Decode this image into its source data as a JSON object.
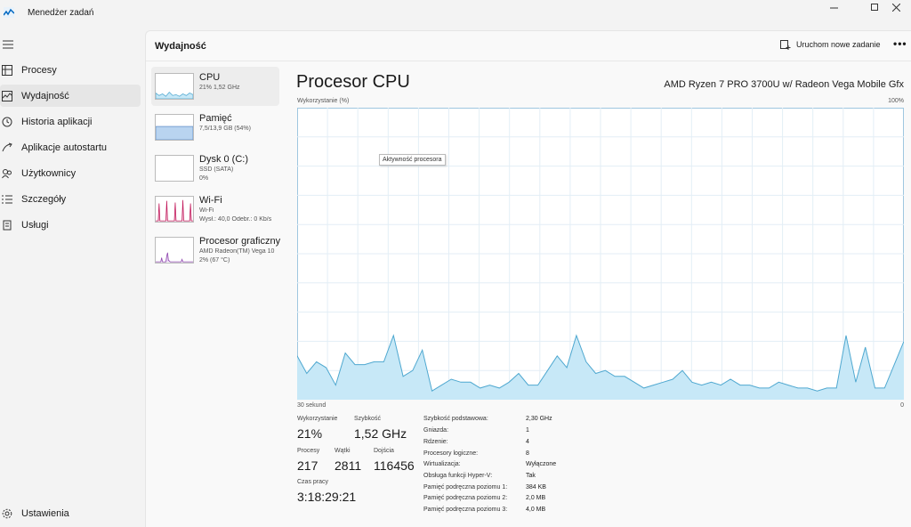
{
  "app": {
    "title": "Menedżer zadań",
    "accent": "#0067c0"
  },
  "nav": {
    "toggle_icon": "hamburger-icon",
    "items": [
      {
        "label": "Procesy",
        "icon": "processes-icon"
      },
      {
        "label": "Wydajność",
        "icon": "performance-icon",
        "active": true
      },
      {
        "label": "Historia aplikacji",
        "icon": "history-icon"
      },
      {
        "label": "Aplikacje autostartu",
        "icon": "startup-icon"
      },
      {
        "label": "Użytkownicy",
        "icon": "users-icon"
      },
      {
        "label": "Szczegóły",
        "icon": "details-icon"
      },
      {
        "label": "Usługi",
        "icon": "services-icon"
      }
    ],
    "settings_label": "Ustawienia"
  },
  "header": {
    "title": "Wydajność",
    "run_task_label": "Uruchom nowe zadanie",
    "more_label": "•••"
  },
  "resources": [
    {
      "name": "CPU",
      "sub1": "21%  1,52 GHz",
      "sub2": "",
      "active": true
    },
    {
      "name": "Pamięć",
      "sub1": "7,5/13,9 GB (54%)",
      "sub2": ""
    },
    {
      "name": "Dysk 0 (C:)",
      "sub1": "SSD (SATA)",
      "sub2": "0%"
    },
    {
      "name": "Wi-Fi",
      "sub1": "Wi-Fi",
      "sub2": "Wysł.: 40,0  Odebr.: 0 Kb/s"
    },
    {
      "name": "Procesor graficzny",
      "sub1": "AMD Radeon(TM) Vega 10",
      "sub2": "2%  (67 °C)"
    }
  ],
  "detail": {
    "title": "Procesor CPU",
    "model": "AMD Ryzen 7 PRO 3700U w/ Radeon Vega Mobile Gfx",
    "tooltip": "Aktywność procesora"
  },
  "chart_data": {
    "type": "area",
    "ylabel": "Wykorzystanie (%)",
    "y_max_label": "100%",
    "x_left_label": "30 sekund",
    "x_right_label": "0",
    "ylim": [
      0,
      100
    ],
    "fill_color": "#c7e8f7",
    "line_color": "#4fa8d0",
    "values": [
      15,
      9,
      13,
      11,
      5,
      16,
      12,
      12,
      13,
      13,
      22,
      8,
      10,
      17,
      3,
      5,
      7,
      6,
      6,
      4,
      5,
      4,
      6,
      9,
      5,
      5,
      10,
      15,
      11,
      22,
      13,
      9,
      10,
      8,
      8,
      6,
      4,
      5,
      6,
      7,
      10,
      6,
      5,
      6,
      5,
      7,
      5,
      5,
      4,
      4,
      6,
      5,
      4,
      4,
      3,
      4,
      4,
      22,
      6,
      18,
      4,
      4,
      12,
      20
    ]
  },
  "stats": {
    "usage_label": "Wykorzystanie",
    "usage_value": "21%",
    "speed_label": "Szybkość",
    "speed_value": "1,52 GHz",
    "processes_label": "Procesy",
    "processes_value": "217",
    "threads_label": "Wątki",
    "threads_value": "2811",
    "handles_label": "Dojścia",
    "handles_value": "116456",
    "uptime_label": "Czas pracy",
    "uptime_value": "3:18:29:21"
  },
  "specs": [
    {
      "label": "Szybkość podstawowa:",
      "value": "2,30 GHz"
    },
    {
      "label": "Gniazda:",
      "value": "1"
    },
    {
      "label": "Rdzenie:",
      "value": "4"
    },
    {
      "label": "Procesory logiczne:",
      "value": "8"
    },
    {
      "label": "Wirtualizacja:",
      "value": "Wyłączone"
    },
    {
      "label": "Obsługa funkcji Hyper-V:",
      "value": "Tak"
    },
    {
      "label": "Pamięć podręczna poziomu 1:",
      "value": "384 KB"
    },
    {
      "label": "Pamięć podręczna poziomu 2:",
      "value": "2,0 MB"
    },
    {
      "label": "Pamięć podręczna poziomu 3:",
      "value": "4,0 MB"
    }
  ]
}
